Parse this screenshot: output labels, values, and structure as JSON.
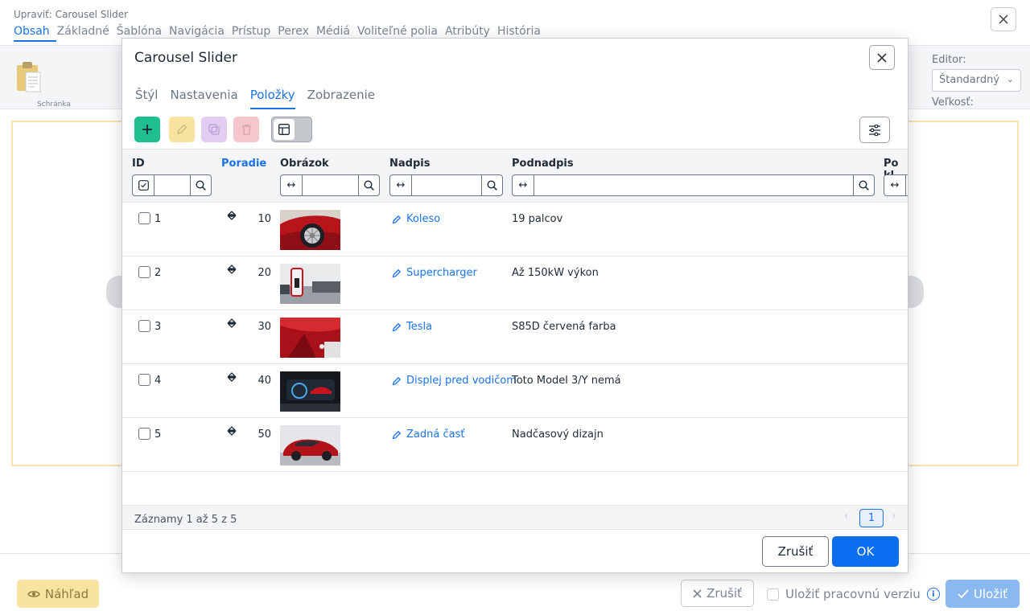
{
  "background": {
    "window_title": "Upraviť: Carousel Slider",
    "tabs": [
      {
        "label": "Obsah",
        "active": true
      },
      {
        "label": "Základné"
      },
      {
        "label": "Šablóna"
      },
      {
        "label": "Navigácia"
      },
      {
        "label": "Prístup"
      },
      {
        "label": "Perex"
      },
      {
        "label": "Médiá"
      },
      {
        "label": "Voliteľné polia"
      },
      {
        "label": "Atribúty"
      },
      {
        "label": "História"
      }
    ],
    "toolbar": {
      "clipboard_label": "Schránka",
      "editor_label": "Editor:",
      "editor_value": "Štandardný",
      "size_label": "Veľkosť:"
    },
    "bottom": {
      "preview_label": "Náhľad",
      "cancel_label": "Zrušiť",
      "save_version_label": "Uložiť pracovnú verziu",
      "save_label": "Uložiť"
    }
  },
  "modal": {
    "title": "Carousel Slider",
    "tabs": [
      {
        "label": "Štýl"
      },
      {
        "label": "Nastavenia"
      },
      {
        "label": "Položky",
        "active": true
      },
      {
        "label": "Zobrazenie"
      }
    ],
    "columns": {
      "id": "ID",
      "order": "Poradie",
      "image": "Obrázok",
      "title": "Nadpis",
      "subtitle": "Podnadpis",
      "extra": "Po kl"
    },
    "rows": [
      {
        "id": "1",
        "order": "10",
        "title": "Koleso",
        "subtitle": "19 palcov",
        "thumb": "wheel"
      },
      {
        "id": "2",
        "order": "20",
        "title": "Supercharger",
        "subtitle": "Až 150kW výkon",
        "thumb": "charger"
      },
      {
        "id": "3",
        "order": "30",
        "title": "Tesla",
        "subtitle": "S85D červená farba",
        "thumb": "red-body"
      },
      {
        "id": "4",
        "order": "40",
        "title": "Displej pred vodičom",
        "subtitle": "Toto Model 3/Y nemá",
        "thumb": "display"
      },
      {
        "id": "5",
        "order": "50",
        "title": "Zadná časť",
        "subtitle": "Nadčasový dizajn",
        "thumb": "rear"
      }
    ],
    "footer": {
      "info": "Záznamy 1 až 5 z 5",
      "current_page": "1"
    },
    "buttons": {
      "cancel": "Zrušiť",
      "ok": "OK"
    }
  }
}
